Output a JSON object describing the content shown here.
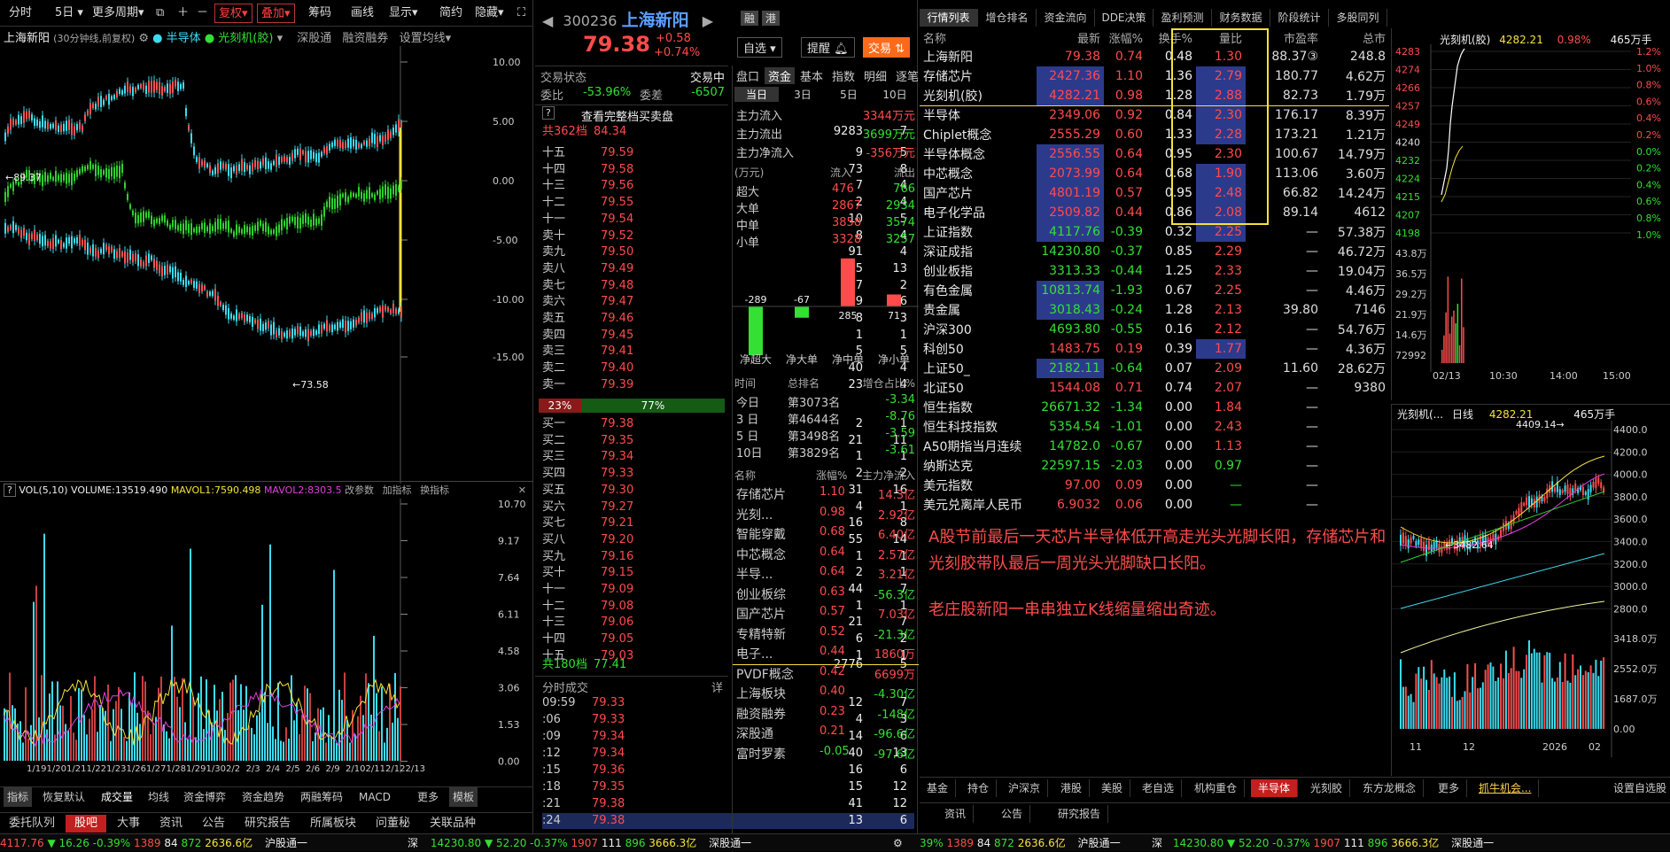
{
  "toolbar": {
    "items": [
      "分时",
      "5日",
      "更多周期",
      "复权",
      "叠加",
      "筹码",
      "画线",
      "显示",
      "简约",
      "隐藏"
    ]
  },
  "chart": {
    "title": "上海新阳",
    "subtitle": "(30分钟线,前复权)",
    "overlay1": "半导体",
    "overlay2": "光刻机(胶)",
    "link1": "深股通",
    "link2": "融资融券",
    "link3": "设置均线",
    "y_ticks": [
      "10.00",
      "5.00",
      "0.00",
      "-5.00",
      "-10.00",
      "-15.00"
    ],
    "hi_label": "89.37",
    "lo_label": "73.58",
    "vol_title": "VOL(5,10)",
    "vol_value": "VOLUME:13519.490",
    "mavol1": "MAVOL1:7590.498",
    "mavol2": "MAVOL2:8303.5",
    "vol_link1": "改参数",
    "vol_link2": "加指标",
    "vol_link3": "换指标",
    "vol_ticks": [
      "10.70",
      "9.17",
      "7.64",
      "6.11",
      "4.58",
      "3.06",
      "1.53",
      "0.00"
    ],
    "x_ticks": [
      "1/19",
      "1/20",
      "1/21",
      "1/22",
      "1/23",
      "1/26",
      "1/27",
      "1/28",
      "1/29",
      "1/30",
      "2/2",
      "2/3",
      "2/4",
      "2/5",
      "2/6",
      "2/9",
      "2/10",
      "2/11",
      "2/12",
      "2/13"
    ],
    "tabs": [
      "指标",
      "恢复默认",
      "成交量",
      "均线",
      "资金博弈",
      "资金趋势",
      "两融筹码",
      "MACD",
      "更多",
      "模板"
    ]
  },
  "bottom_left": {
    "tabs": [
      "委托队列",
      "股吧",
      "大事",
      "资讯",
      "公告",
      "研究报告",
      "所属板块",
      "问董秘",
      "关联品种"
    ]
  },
  "stock": {
    "code": "300236",
    "name": "上海新阳",
    "price": "79.38",
    "change": "+0.58",
    "pct": "+0.74%",
    "btn_self": "自选",
    "btn_remind": "提醒",
    "btn_trade": "交易",
    "tag1": "融",
    "tag2": "港"
  },
  "status": {
    "label": "交易状态",
    "value": "交易中",
    "weibi_l": "委比",
    "weibi": "-53.96%",
    "weicha_l": "委差",
    "weicha": "-6507",
    "full_btn": "查看完整档买卖盘"
  },
  "ask_total": {
    "label": "共362档",
    "price": "84.34",
    "vol": "9283",
    "n": "7"
  },
  "asks": [
    [
      "十五",
      "79.59",
      "9",
      "5"
    ],
    [
      "十四",
      "79.58",
      "73",
      "8"
    ],
    [
      "十三",
      "79.56",
      "7",
      "4"
    ],
    [
      "十二",
      "79.55",
      "2",
      "4"
    ],
    [
      "十一",
      "79.54",
      "10",
      "5"
    ],
    [
      "卖十",
      "79.52",
      "8",
      "4"
    ],
    [
      "卖九",
      "79.50",
      "91",
      "4"
    ],
    [
      "卖八",
      "79.49",
      "25",
      "13"
    ],
    [
      "卖七",
      "79.48",
      "7",
      "2"
    ],
    [
      "卖六",
      "79.47",
      "19",
      "6"
    ],
    [
      "卖五",
      "79.46",
      "8",
      "3"
    ],
    [
      "卖四",
      "79.45",
      "1",
      "1"
    ],
    [
      "卖三",
      "79.41",
      "5",
      "5"
    ],
    [
      "卖二",
      "79.40",
      "40",
      "4"
    ],
    [
      "卖一",
      "79.39",
      "23",
      "4"
    ]
  ],
  "ratio": {
    "buy": "23%",
    "sell": "77%"
  },
  "bids": [
    [
      "买一",
      "79.38",
      "2",
      "1"
    ],
    [
      "买二",
      "79.35",
      "21",
      "11"
    ],
    [
      "买三",
      "79.34",
      "1",
      "1"
    ],
    [
      "买四",
      "79.33",
      "2",
      "2"
    ],
    [
      "买五",
      "79.30",
      "31",
      "16"
    ],
    [
      "买六",
      "79.27",
      "4",
      "1"
    ],
    [
      "买七",
      "79.21",
      "16",
      "8"
    ],
    [
      "买八",
      "79.20",
      "55",
      "14"
    ],
    [
      "买九",
      "79.16",
      "1",
      "1"
    ],
    [
      "买十",
      "79.15",
      "2",
      "1"
    ],
    [
      "十一",
      "79.09",
      "44",
      "7"
    ],
    [
      "十二",
      "79.08",
      "1",
      "1"
    ],
    [
      "十三",
      "79.06",
      "21",
      "7"
    ],
    [
      "十四",
      "79.05",
      "6",
      "2"
    ],
    [
      "十五",
      "79.03",
      "1",
      "1"
    ]
  ],
  "bid_total": {
    "label": "共180档",
    "price": "77.41",
    "vol": "2776",
    "n": "5"
  },
  "ticks_title": "分时成交",
  "ticks_link": "详",
  "ticks": [
    [
      "09:59",
      "79.33",
      "12",
      "7"
    ],
    [
      ":06",
      "79.33",
      "4",
      "3"
    ],
    [
      ":09",
      "79.34",
      "14",
      "6"
    ],
    [
      ":12",
      "79.34",
      "40",
      "13"
    ],
    [
      ":15",
      "79.36",
      "16",
      "6"
    ],
    [
      ":18",
      "79.35",
      "15",
      "12"
    ],
    [
      ":21",
      "79.38",
      "41",
      "12"
    ],
    [
      ":24",
      "79.38",
      "13",
      "6"
    ]
  ],
  "fund": {
    "tabs": [
      "盘口",
      "资金",
      "基本",
      "指数",
      "明细",
      "逐笔"
    ],
    "periods": [
      "当日",
      "3日",
      "5日",
      "10日"
    ],
    "main": [
      [
        "主力流入",
        "3344万元"
      ],
      [
        "主力流出",
        "3699万元"
      ],
      [
        "主力净流入",
        "-356万元"
      ]
    ],
    "table_head": [
      "(万元)",
      "流入",
      "流出"
    ],
    "table": [
      [
        "超大",
        "476",
        "766"
      ],
      [
        "大单",
        "2867",
        "2934"
      ],
      [
        "中单",
        "3858",
        "3574"
      ],
      [
        "小单",
        "3328",
        "3257"
      ]
    ],
    "bars": [
      {
        "label": "净超大",
        "value": -289
      },
      {
        "label": "净大单",
        "value": -67
      },
      {
        "label": "净中单",
        "value": 285
      },
      {
        "label": "净小单",
        "value": 71
      }
    ],
    "rank_head": [
      "时间",
      "总排名",
      "增仓占比%"
    ],
    "rank": [
      [
        "今日",
        "第3073名",
        "-3.34"
      ],
      [
        "3 日",
        "第4644名",
        "-8.76"
      ],
      [
        "5 日",
        "第3498名",
        "-3.59"
      ],
      [
        "10日",
        "第3829名",
        "-3.61"
      ]
    ],
    "sector_head": [
      "名称",
      "涨幅%",
      "主力净流入"
    ],
    "sectors": [
      [
        "存储芯片",
        "1.10",
        "14.3亿"
      ],
      [
        "光刻...",
        "0.98",
        "2.92亿"
      ],
      [
        "智能穿戴",
        "0.68",
        "6.40亿"
      ],
      [
        "中芯概念",
        "0.64",
        "2.57亿"
      ],
      [
        "半导...",
        "0.64",
        "3.21亿"
      ],
      [
        "创业板综",
        "0.63",
        "-56.3亿"
      ],
      [
        "国产芯片",
        "0.57",
        "7.03亿"
      ],
      [
        "专精特新",
        "0.52",
        "-21.3亿"
      ],
      [
        "电子...",
        "0.44",
        "1860万"
      ],
      [
        "PVDF概念",
        "0.42",
        "6699万"
      ],
      [
        "上海板块",
        "0.40",
        "-4.30亿"
      ],
      [
        "融资融券",
        "0.23",
        "-148亿"
      ],
      [
        "深股通",
        "0.21",
        "-96.6亿"
      ],
      [
        "富时罗素",
        "-0.05",
        "-97.6亿"
      ]
    ]
  },
  "quote_tabs": [
    "行情列表",
    "增仓排名",
    "资金流向",
    "DDE决策",
    "盈利预测",
    "财务数据",
    "阶段统计",
    "多股同列"
  ],
  "quote_head": [
    "名称",
    "最新",
    "涨幅%",
    "换手%",
    "量比",
    "市盈率",
    "总市"
  ],
  "quotes": [
    [
      "上海新阳",
      "79.38",
      "0.74",
      "0.48",
      "1.30",
      "88.37③",
      "248.8"
    ],
    [
      "存储芯片",
      "2427.36",
      "1.10",
      "1.36",
      "2.79",
      "180.77",
      "4.62万"
    ],
    [
      "光刻机(胶)",
      "4282.21",
      "0.98",
      "1.28",
      "2.88",
      "82.73",
      "1.79万"
    ],
    [
      "半导体",
      "2349.06",
      "0.92",
      "0.84",
      "2.30",
      "176.17",
      "8.39万"
    ],
    [
      "Chiplet概念",
      "2555.29",
      "0.60",
      "1.33",
      "2.28",
      "173.21",
      "1.21万"
    ],
    [
      "半导体概念",
      "2556.55",
      "0.64",
      "0.95",
      "2.30",
      "100.67",
      "14.79万"
    ],
    [
      "中芯概念",
      "2073.99",
      "0.64",
      "0.68",
      "1.90",
      "113.06",
      "3.60万"
    ],
    [
      "国产芯片",
      "4801.19",
      "0.57",
      "0.95",
      "2.48",
      "66.82",
      "14.24万"
    ],
    [
      "电子化学品",
      "2509.82",
      "0.44",
      "0.86",
      "2.08",
      "89.14",
      "4612"
    ],
    [
      "上证指数",
      "4117.76",
      "-0.39",
      "0.32",
      "2.25",
      "—",
      "57.38万"
    ],
    [
      "深证成指",
      "14230.80",
      "-0.37",
      "0.85",
      "2.29",
      "—",
      "46.72万"
    ],
    [
      "创业板指",
      "3313.33",
      "-0.44",
      "1.25",
      "2.33",
      "—",
      "19.04万"
    ],
    [
      "有色金属",
      "10813.74",
      "-1.93",
      "0.67",
      "2.25",
      "—",
      "4.46万"
    ],
    [
      "贵金属",
      "3018.43",
      "-0.24",
      "1.28",
      "2.13",
      "39.80",
      "7146"
    ],
    [
      "沪深300",
      "4693.80",
      "-0.55",
      "0.16",
      "2.12",
      "—",
      "54.76万"
    ],
    [
      "科创50",
      "1483.75",
      "0.19",
      "0.39",
      "1.77",
      "—",
      "4.36万"
    ],
    [
      "上证50_",
      "2182.11",
      "-0.64",
      "0.07",
      "2.09",
      "11.60",
      "28.62万"
    ],
    [
      "北证50",
      "1544.08",
      "0.71",
      "0.74",
      "2.07",
      "—",
      "9380"
    ],
    [
      "恒生指数",
      "26671.32",
      "-1.34",
      "0.00",
      "1.84",
      "—",
      ""
    ],
    [
      "恒生科技指数",
      "5354.54",
      "-1.01",
      "0.00",
      "2.43",
      "—",
      ""
    ],
    [
      "A50期指当月连续",
      "14782.0",
      "-0.67",
      "0.00",
      "1.13",
      "—",
      ""
    ],
    [
      "纳斯达克",
      "22597.15",
      "-2.03",
      "0.00",
      "0.97",
      "—",
      ""
    ],
    [
      "美元指数",
      "97.00",
      "0.09",
      "0.00",
      "—",
      "—",
      ""
    ],
    [
      "美元兑离岸人民币",
      "6.9032",
      "0.06",
      "0.00",
      "—",
      "—",
      ""
    ]
  ],
  "note": {
    "line1": "A股节前最后一天芯片半导体低开高走光头光脚长阳，存储芯片和光刻胶带队最后一周光头光脚缺口长阳。",
    "line2": "老庄股新阳一串串独立K线缩量缩出奇迹。"
  },
  "mini1": {
    "title": "光刻机(胶)",
    "price": "4282.21",
    "pct": "0.98%",
    "vol": "465万手",
    "y_left": [
      "4283",
      "4274",
      "4266",
      "4257",
      "4249",
      "4240",
      "4232",
      "4224",
      "4215",
      "4207",
      "4198"
    ],
    "y_right": [
      "1.2%",
      "1.0%",
      "0.8%",
      "0.6%",
      "0.4%",
      "0.2%",
      "0.0%",
      "0.2%",
      "0.4%",
      "0.6%",
      "0.8%",
      "1.0%"
    ],
    "vol_ticks": [
      "43.8万",
      "36.5万",
      "29.2万",
      "21.9万",
      "14.6万",
      "72992"
    ],
    "x_ticks": [
      "02/13",
      "10:30",
      "14:00",
      "15:00"
    ]
  },
  "mini2": {
    "title": "光刻机(...",
    "period": "日线",
    "price": "4282.21",
    "vol": "465万手",
    "hi": "4409.14",
    "lo": "3482.64",
    "y_ticks": [
      "4400.0",
      "4200.0",
      "4000.0",
      "3800.0",
      "3600.0",
      "3400.0",
      "3200.0",
      "3000.0",
      "2800.0"
    ],
    "vol_ticks": [
      "3418.0万",
      "2552.0万",
      "1687.0万",
      "0.00"
    ],
    "x_ticks": [
      "11",
      "12",
      "2026",
      "02"
    ]
  },
  "sector_tabs": [
    "基金",
    "持仓",
    "沪深京",
    "港股",
    "美股",
    "老自选",
    "机构重仓",
    "半导体",
    "光刻胶",
    "东方龙概念",
    "更多",
    "抓牛机会...",
    "设置自选股"
  ],
  "right_bottom_tabs": [
    "资讯",
    "公告",
    "研究报告"
  ],
  "statusbar": {
    "sh_idx": "4117.76",
    "sh_chg": "16.26",
    "sh_pct": "-0.39%",
    "sh_up": "1389",
    "sh_flat": "84",
    "sh_dn": "872",
    "sh_amt": "2636.6亿",
    "hgt": "沪股通",
    "sz": "深",
    "sz_idx": "14230.80",
    "sz_chg": "52.20",
    "sz_pct": "-0.37%",
    "sz_up": "1907",
    "sz_flat": "111",
    "sz_dn": "896",
    "sz_amt": "3666.3亿",
    "sgt": "深股通",
    "sh2_pct": "39%",
    "sh2_up": "1389",
    "sh2_flat": "84",
    "sh2_dn": "872",
    "sh2_amt": "2636.6亿",
    "hgt2": "沪股通",
    "sz2": "深",
    "sz2_idx": "14230.80",
    "sz2_chg": "52.20",
    "sz2_pct": "-0.37%",
    "sz2_up": "1907",
    "sz2_flat": "111",
    "sz2_dn": "896",
    "sz2_amt": "3666.3亿",
    "sgt2": "深股通"
  },
  "colors": {
    "up": "#ff4b4b",
    "down": "#33e033",
    "accent": "#f5e23a",
    "cyan": "#3cdcf0"
  }
}
